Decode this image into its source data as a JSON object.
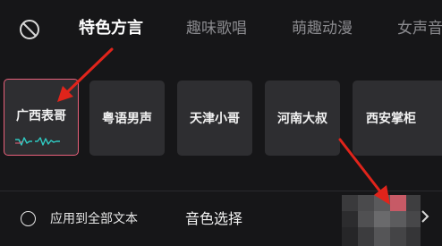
{
  "tabs": [
    {
      "label": "特色方言",
      "active": true
    },
    {
      "label": "趣味歌唱",
      "active": false
    },
    {
      "label": "萌趣动漫",
      "active": false
    },
    {
      "label": "女声音",
      "active": false
    }
  ],
  "voices": [
    {
      "label": "广西表哥",
      "selected": true
    },
    {
      "label": "粤语男声",
      "selected": false
    },
    {
      "label": "天津小哥",
      "selected": false
    },
    {
      "label": "河南大叔",
      "selected": false
    },
    {
      "label": "西安掌柜",
      "selected": false
    }
  ],
  "bottom": {
    "apply_all_label": "应用到全部文本",
    "apply_all_checked": false,
    "voice_select_label": "音色选择"
  },
  "colors": {
    "background": "#161618",
    "card": "#2e2e31",
    "selected_border": "#e8607a",
    "wave_accent": "#2fc9c1",
    "annotation_arrow": "#e0241b"
  },
  "icons": {
    "disable": "no-voice-icon",
    "wave": "audio-wave-icon",
    "radio": "radio-button-icon",
    "chevron": "chevron-right-icon"
  }
}
